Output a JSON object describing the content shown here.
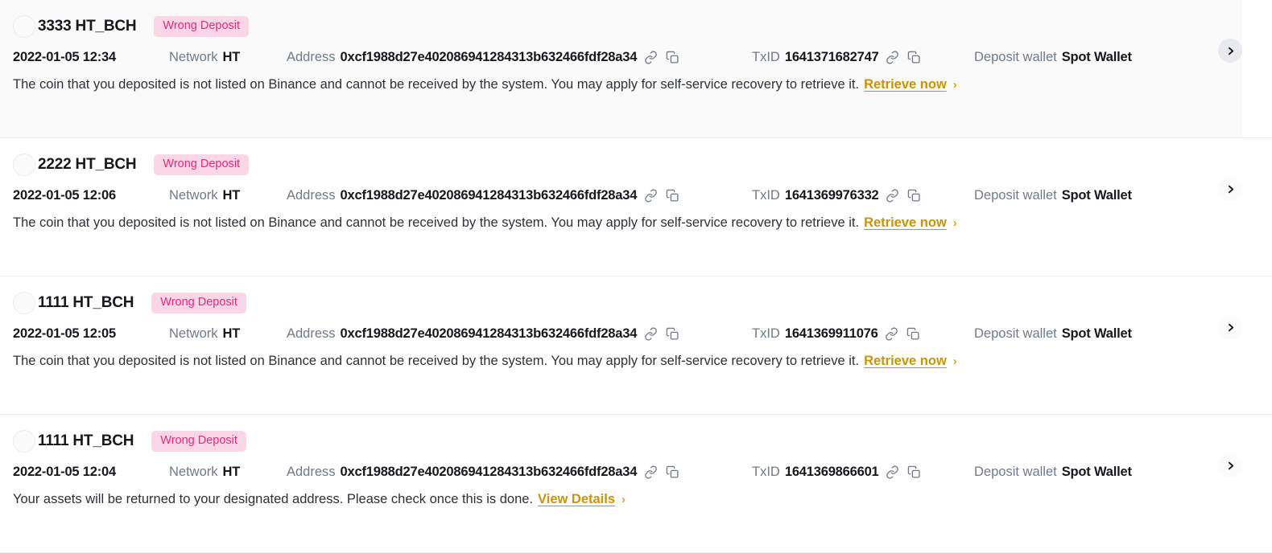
{
  "labels": {
    "network": "Network",
    "address": "Address",
    "txid": "TxID",
    "deposit_wallet": "Deposit wallet"
  },
  "colors": {
    "badge_bg": "#fbd7e6",
    "badge_text": "#e6287e",
    "link": "#c99400",
    "row_hover_bg": "#fafafa",
    "separator": "#eaecef",
    "label_text": "#707a8a",
    "value_text": "#16181c"
  },
  "icons": {
    "link": "link-icon",
    "copy": "copy-icon",
    "chevron": "chevron-right-icon",
    "link_arrow": "›"
  },
  "rows": [
    {
      "amount": "3333 HT_BCH",
      "status": "Wrong Deposit",
      "time": "2022-01-05 12:34",
      "network": "HT",
      "address": "0xcf1988d27e402086941284313b632466fdf28a34",
      "txid": "1641371682747",
      "wallet": "Spot Wallet",
      "description": "The coin that you deposited is not listed on Binance and cannot be received by the system. You may apply for self-service recovery to retrieve it.",
      "link_text": "Retrieve now",
      "hovered": true
    },
    {
      "amount": "2222 HT_BCH",
      "status": "Wrong Deposit",
      "time": "2022-01-05 12:06",
      "network": "HT",
      "address": "0xcf1988d27e402086941284313b632466fdf28a34",
      "txid": "1641369976332",
      "wallet": "Spot Wallet",
      "description": "The coin that you deposited is not listed on Binance and cannot be received by the system. You may apply for self-service recovery to retrieve it.",
      "link_text": "Retrieve now",
      "hovered": false
    },
    {
      "amount": "1111 HT_BCH",
      "status": "Wrong Deposit",
      "time": "2022-01-05 12:05",
      "network": "HT",
      "address": "0xcf1988d27e402086941284313b632466fdf28a34",
      "txid": "1641369911076",
      "wallet": "Spot Wallet",
      "description": "The coin that you deposited is not listed on Binance and cannot be received by the system. You may apply for self-service recovery to retrieve it.",
      "link_text": "Retrieve now",
      "hovered": false
    },
    {
      "amount": "1111 HT_BCH",
      "status": "Wrong Deposit",
      "time": "2022-01-05 12:04",
      "network": "HT",
      "address": "0xcf1988d27e402086941284313b632466fdf28a34",
      "txid": "1641369866601",
      "wallet": "Spot Wallet",
      "description": "Your assets will be returned to your designated address. Please check once this is done.",
      "link_text": "View Details",
      "hovered": false
    }
  ]
}
